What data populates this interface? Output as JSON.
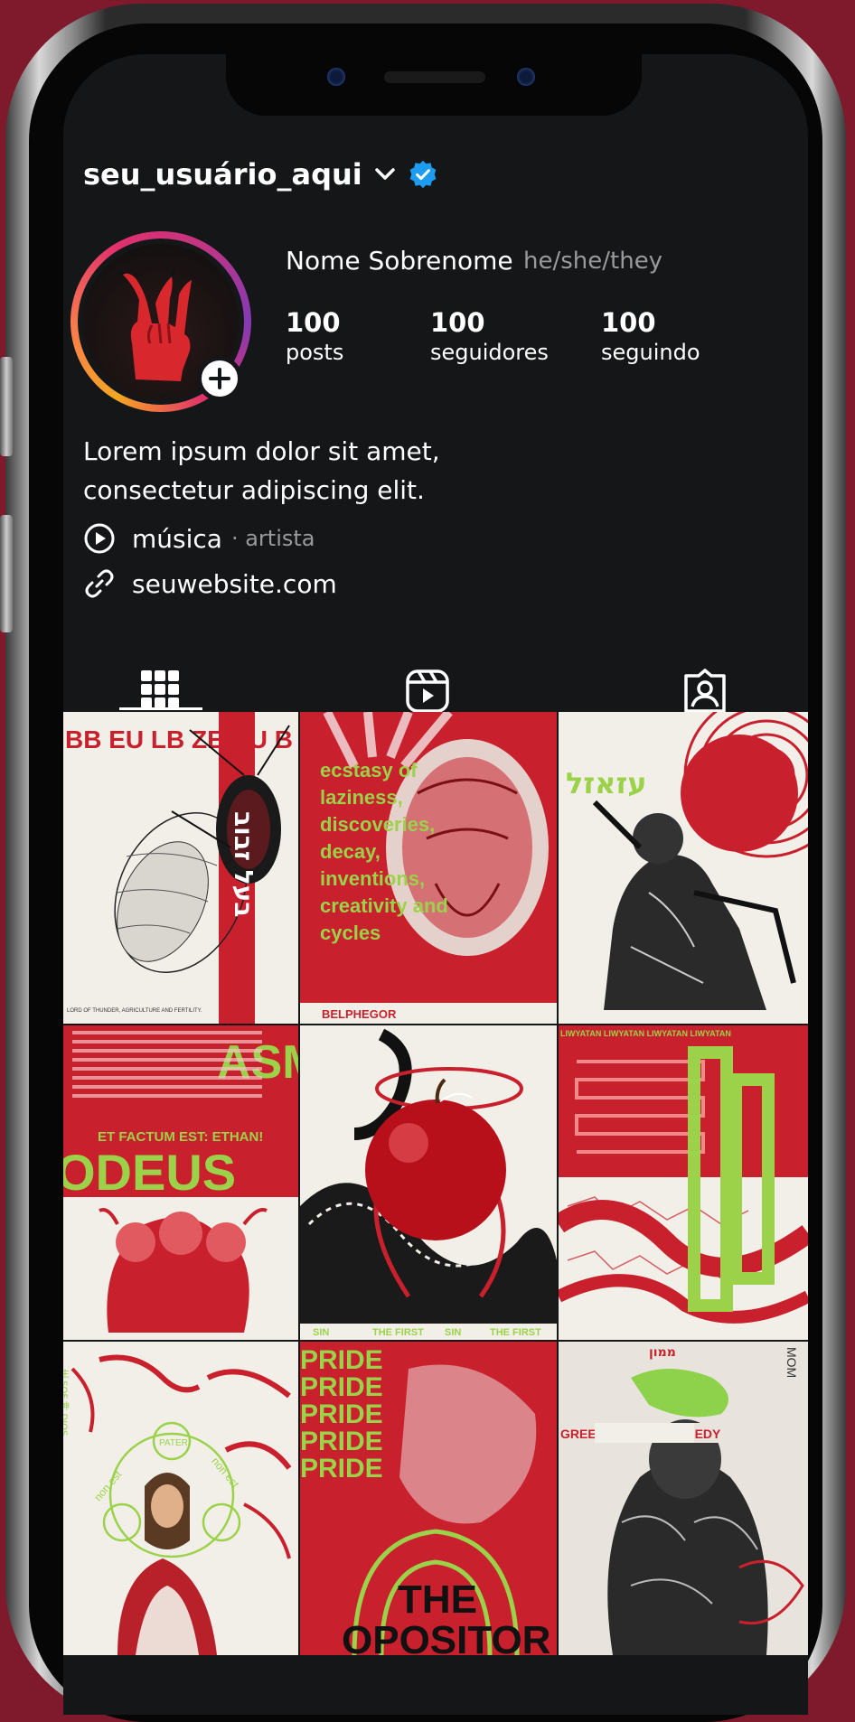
{
  "profile": {
    "username": "seu_usuário_aqui",
    "name": "Nome Sobrenome",
    "pronouns": "he/she/they",
    "bio_line1": "Lorem ipsum dolor sit amet,",
    "bio_line2": "consectetur adipiscing elit.",
    "category": "música",
    "category_sub": "· artista",
    "website": "seuwebsite.com"
  },
  "stats": [
    {
      "value": "100",
      "label": "posts"
    },
    {
      "value": "100",
      "label": "seguidores"
    },
    {
      "value": "100",
      "label": "seguindo"
    }
  ],
  "tabs": [
    {
      "icon": "grid-icon",
      "active": true
    },
    {
      "icon": "reels-icon",
      "active": false
    },
    {
      "icon": "tagged-icon",
      "active": false
    }
  ],
  "posts": {
    "p1": {
      "title_letters": "BB EU LB ZE BU B",
      "hebrew": "בעל זבוב",
      "caption": "LORD OF THUNDER, AGRICULTURE AND FERTILITY."
    },
    "p2": {
      "text": "ecstasy of laziness, discoveries, decay, inventions, creativity and cycles",
      "footer": "BELPHEGOR"
    },
    "p3": {
      "hebrew": "עזאזל"
    },
    "p4": {
      "top": "ASMO",
      "mid": "ET FACTUM EST: ETHAN!",
      "big": "ODEUS"
    },
    "p5": {
      "footer1": "SIN",
      "footer2": "THE FIRST"
    },
    "p6": {
      "band": "LIWYATAN LIWYATAN LIWYATAN LIWYATAN"
    },
    "p7": {
      "ring_top": "PATER",
      "ring_left": "non est",
      "ring_right": "non est"
    },
    "p8": {
      "repeat": "PRIDE",
      "bottom1": "THE",
      "bottom2": "OPOSITOR"
    },
    "p9": {
      "band": "GREEDYGREEDYGREEDY",
      "hebrew": "ממון",
      "side": "MOM"
    }
  },
  "colors": {
    "bg": "#141618",
    "red": "#c8202d",
    "green": "#8dd24a",
    "verified": "#1d9bf0"
  }
}
